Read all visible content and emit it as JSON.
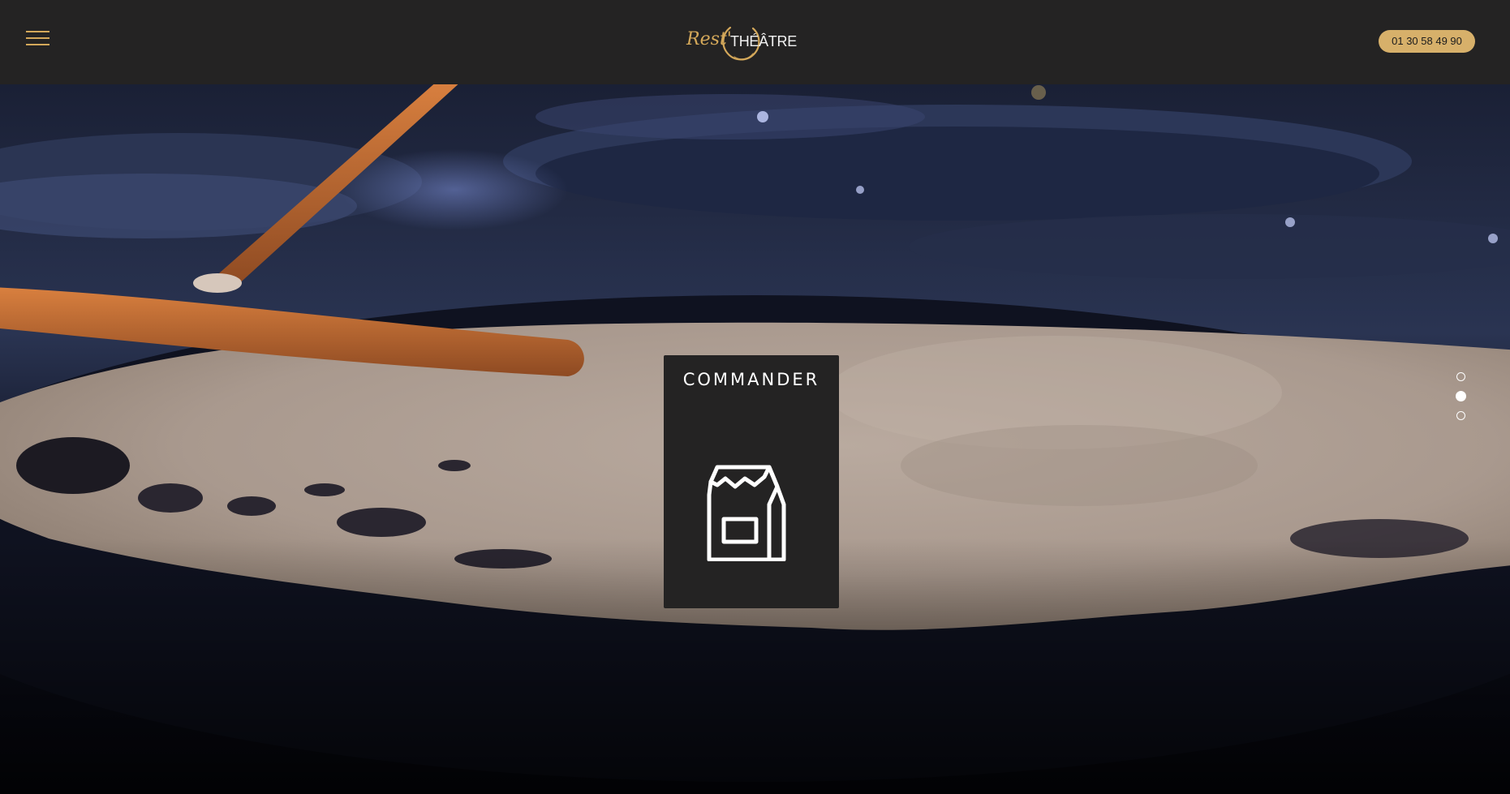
{
  "header": {
    "logo": {
      "script_text": "Rest'",
      "word_text": "THÉÂTRE",
      "accent_color": "#d4a85a"
    },
    "menu_icon": "hamburger-menu-icon",
    "phone_number": "01 30 58 49 90",
    "phone_button_color": "#d7b06a",
    "background_color": "#242323"
  },
  "hero": {
    "image_description_icon": "crepe-pan-photo",
    "card": {
      "label": "COMMANDER",
      "icon": "takeaway-bag-icon",
      "background_color": "#242323"
    },
    "slider": {
      "dot_count": 3,
      "active_index": 1
    }
  }
}
